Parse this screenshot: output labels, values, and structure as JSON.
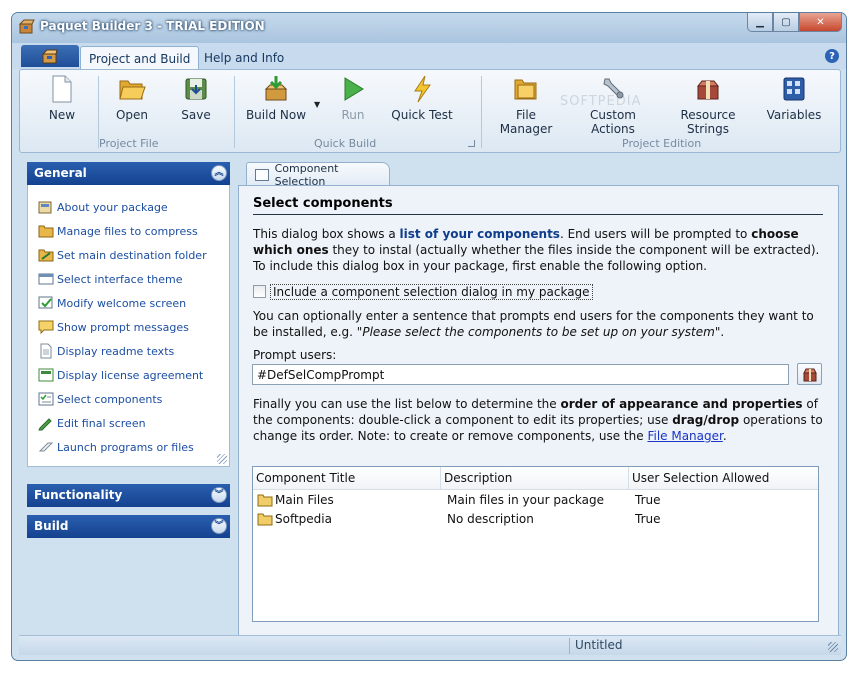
{
  "window": {
    "title": "Paquet Builder 3 - TRIAL EDITION",
    "controls": {
      "minimize": "▁",
      "maximize": "▢",
      "close": "✕"
    }
  },
  "ribbon_tabs": [
    {
      "label": "Project and Build"
    },
    {
      "label": "Help and Info"
    }
  ],
  "ribbon": {
    "groups": {
      "project_file": "Project File",
      "quick_build": "Quick Build",
      "project_edition": "Project Edition"
    },
    "buttons": {
      "new": "New",
      "open": "Open",
      "save": "Save",
      "build_now": "Build Now",
      "run": "Run",
      "quick_test": "Quick Test",
      "file_manager": "File Manager",
      "custom_actions": "Custom Actions",
      "resource_strings": "Resource Strings",
      "variables": "Variables"
    },
    "watermark": "SOFTPEDIA"
  },
  "sidebar": {
    "general": {
      "title": "General",
      "items": [
        {
          "label": "About your package"
        },
        {
          "label": "Manage files to compress"
        },
        {
          "label": "Set main destination folder"
        },
        {
          "label": "Select interface theme"
        },
        {
          "label": "Modify welcome screen"
        },
        {
          "label": "Show prompt messages"
        },
        {
          "label": "Display readme texts"
        },
        {
          "label": "Display license agreement"
        },
        {
          "label": "Select components"
        },
        {
          "label": "Edit final screen"
        },
        {
          "label": "Launch programs or files"
        }
      ]
    },
    "functionality": {
      "title": "Functionality"
    },
    "build": {
      "title": "Build"
    }
  },
  "content": {
    "tab_label": "Component Selection",
    "heading": "Select components",
    "intro": {
      "p1": "This dialog box shows a ",
      "p1_bold": "list of your components",
      "p2": ". End users will be prompted to ",
      "p2_bold": "choose which ones",
      "p3": " they to instal (actually whether the files inside the component will be extracted). To include this dialog box in your package, first enable the following option."
    },
    "checkbox_label": "Include a component selection dialog in my package",
    "optional_text": {
      "p1": "You can optionally enter a sentence that prompts end users for the components they want to be installed, e.g. \"",
      "p1_italic": "Please select the components to be set up on your system",
      "p2": "\"."
    },
    "prompt_label": "Prompt users:",
    "prompt_value": "#DefSelCompPrompt",
    "final_text": {
      "p1": "Finally you can use the list below to determine the ",
      "p1_bold": "order of appearance and properties",
      "p2": " of the components: double-click a component to edit its properties; use ",
      "p2_bold": "drag/drop",
      "p3": " operations to change its order. Note: to create or remove components, use the ",
      "link": "File Manager",
      "p4": "."
    },
    "table": {
      "columns": [
        "Component Title",
        "Description",
        "User Selection Allowed"
      ],
      "rows": [
        {
          "title": "Main Files",
          "description": "Main files in your package",
          "allowed": "True"
        },
        {
          "title": "Softpedia",
          "description": "No description",
          "allowed": "True"
        }
      ]
    }
  },
  "statusbar": {
    "text": "Untitled"
  },
  "help_icon": "?"
}
